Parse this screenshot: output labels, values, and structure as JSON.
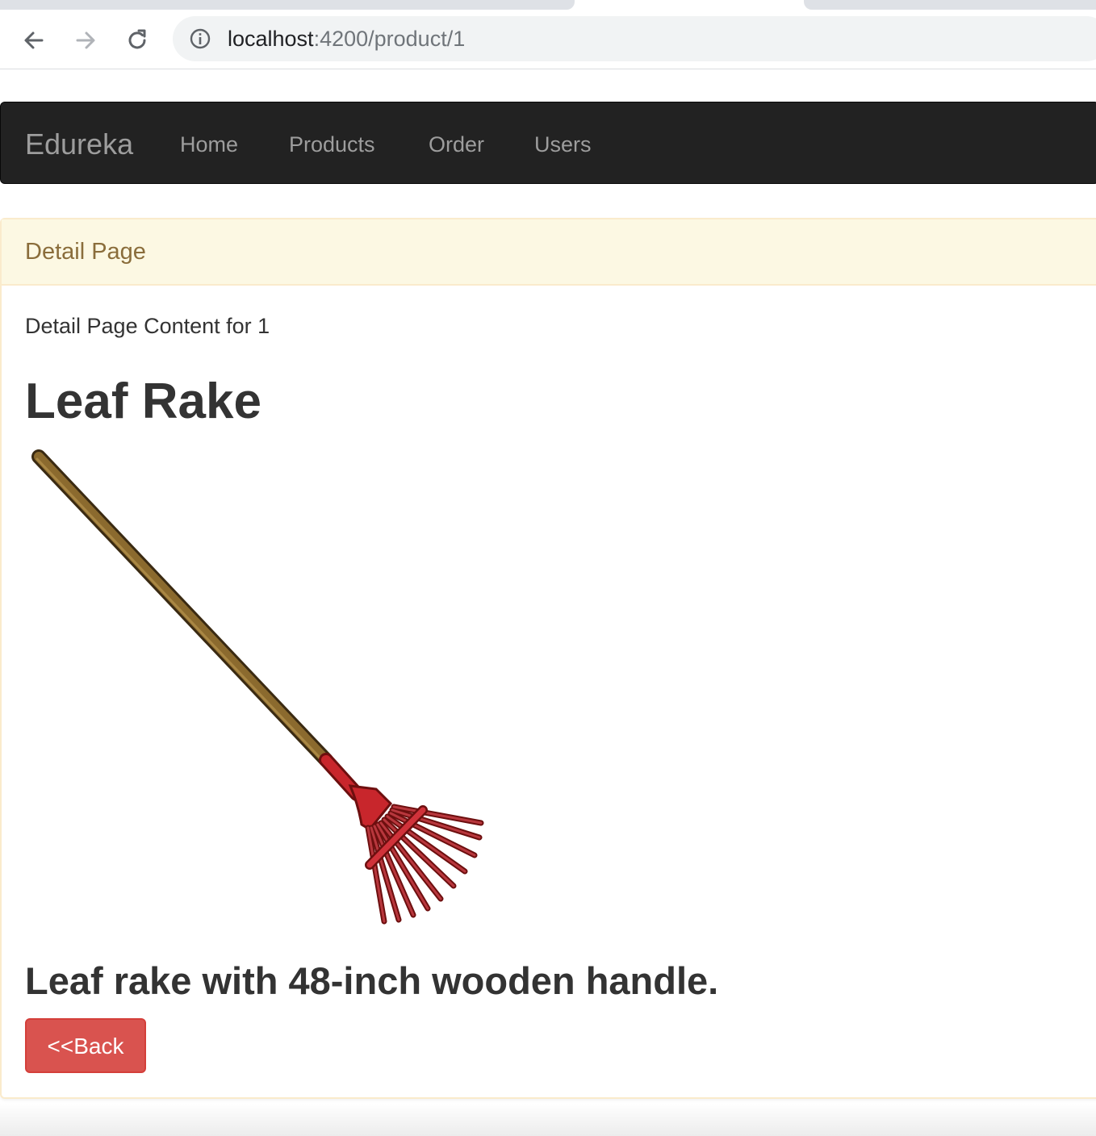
{
  "browser": {
    "url_host": "localhost",
    "url_rest": ":4200/product/1",
    "icons": [
      "back-arrow-icon",
      "forward-arrow-icon",
      "reload-icon",
      "site-info-icon"
    ]
  },
  "navbar": {
    "brand": "Edureka",
    "links": [
      "Home",
      "Products",
      "Order",
      "Users"
    ]
  },
  "panel": {
    "heading": "Detail Page",
    "content_text": "Detail Page Content for 1"
  },
  "product": {
    "name": "Leaf Rake",
    "image": "leaf-rake-image",
    "description": "Leaf rake with 48-inch wooden handle."
  },
  "actions": {
    "back_label": "<<Back"
  },
  "colors": {
    "navbar_bg": "#222222",
    "navbar_text": "#9d9d9d",
    "panel_heading_bg": "#fcf8e3",
    "panel_heading_text": "#8a6d3b",
    "panel_border": "#faebcc",
    "back_button": "#d9534f"
  }
}
